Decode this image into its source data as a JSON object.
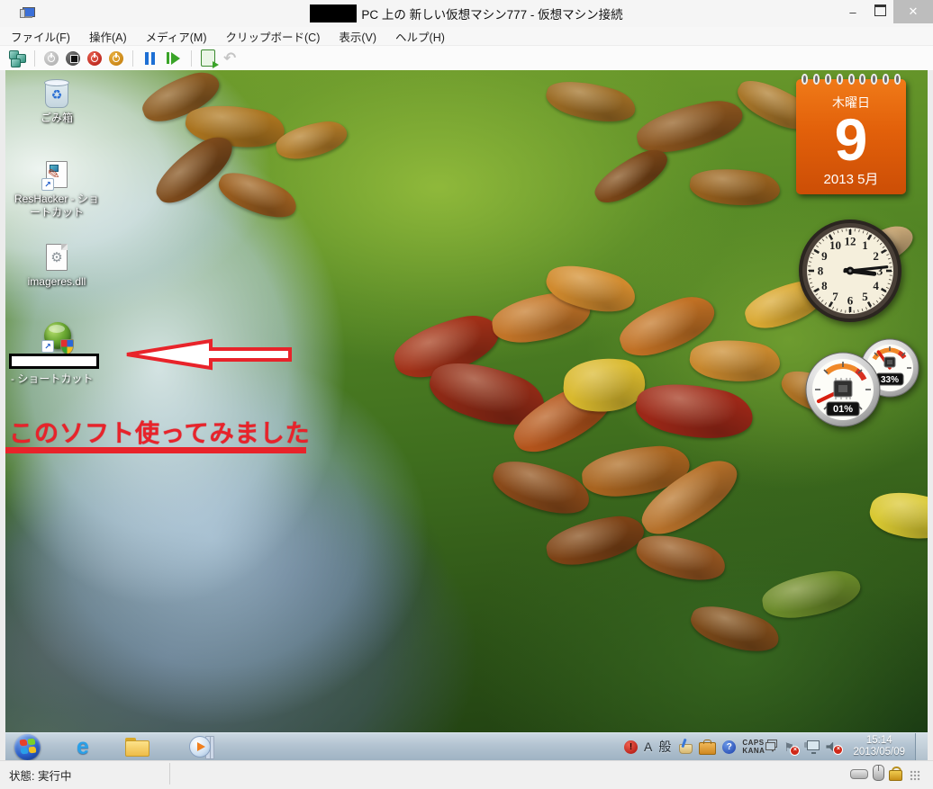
{
  "window": {
    "title": "PC 上の 新しい仮想マシン777  - 仮想マシン接続",
    "title_prefix_redacted": true,
    "controls": {
      "minimize_glyph": "–",
      "close_glyph": "✕"
    }
  },
  "menu": {
    "items": [
      {
        "label": "ファイル(F)"
      },
      {
        "label": "操作(A)"
      },
      {
        "label": "メディア(M)"
      },
      {
        "label": "クリップボード(C)"
      },
      {
        "label": "表示(V)"
      },
      {
        "label": "ヘルプ(H)"
      }
    ]
  },
  "toolbar": {
    "buttons": [
      {
        "icon": "ctrl-alt-del-icon",
        "enabled": true
      },
      {
        "icon": "start-power-icon",
        "enabled": false
      },
      {
        "icon": "turn-off-icon",
        "enabled": true
      },
      {
        "icon": "shut-down-icon",
        "enabled": true
      },
      {
        "icon": "save-state-icon",
        "enabled": true
      },
      {
        "icon": "pause-icon",
        "enabled": true
      },
      {
        "icon": "reset-icon",
        "enabled": true
      },
      {
        "icon": "checkpoint-icon",
        "enabled": true
      },
      {
        "icon": "revert-icon",
        "enabled": false
      }
    ]
  },
  "desktop": {
    "icons": [
      {
        "label": "ごみ箱",
        "icon": "recycle-bin-icon"
      },
      {
        "label": "ResHacker - ショートカット",
        "icon": "reshacker-shortcut-icon"
      },
      {
        "label": "imageres.dll",
        "icon": "dll-file-icon"
      },
      {
        "label": "- ショートカット",
        "icon": "app-shortcut-icon",
        "name_redacted": true
      }
    ],
    "annotation": {
      "text": "このソフト使ってみました",
      "color": "#e8232a",
      "arrow": "left-red-arrow"
    }
  },
  "gadgets": {
    "calendar": {
      "weekday": "木曜日",
      "day": "9",
      "year_month": "2013 5月",
      "accent": "#e2600a"
    },
    "clock": {
      "time": "15:14",
      "numerals": [
        "12",
        "1",
        "2",
        "3",
        "4",
        "5",
        "6",
        "7",
        "8",
        "9",
        "10",
        "11"
      ]
    },
    "cpu_meter": {
      "cpu": "01%",
      "ram": "33%"
    }
  },
  "taskbar": {
    "pinned": [
      {
        "icon": "start-orb-icon"
      },
      {
        "icon": "internet-explorer-icon"
      },
      {
        "icon": "explorer-folder-icon"
      },
      {
        "icon": "media-player-icon"
      }
    ],
    "tray": {
      "ime_mode": "A",
      "ime_kanji": "般",
      "caps": "CAPS",
      "kana": "KANA",
      "time": "15:14",
      "date": "2013/05/09",
      "icons": [
        "ime-notify-icon",
        "ime-brush-icon",
        "ime-toolbox-icon",
        "ime-help-icon",
        "ime-pad-icon",
        "action-center-flag-icon",
        "network-icon",
        "volume-muted-icon"
      ]
    }
  },
  "statusbar": {
    "status_label": "状態: 実行中",
    "icons": [
      "drive-icon",
      "mouse-capture-icon",
      "lock-icon"
    ]
  }
}
